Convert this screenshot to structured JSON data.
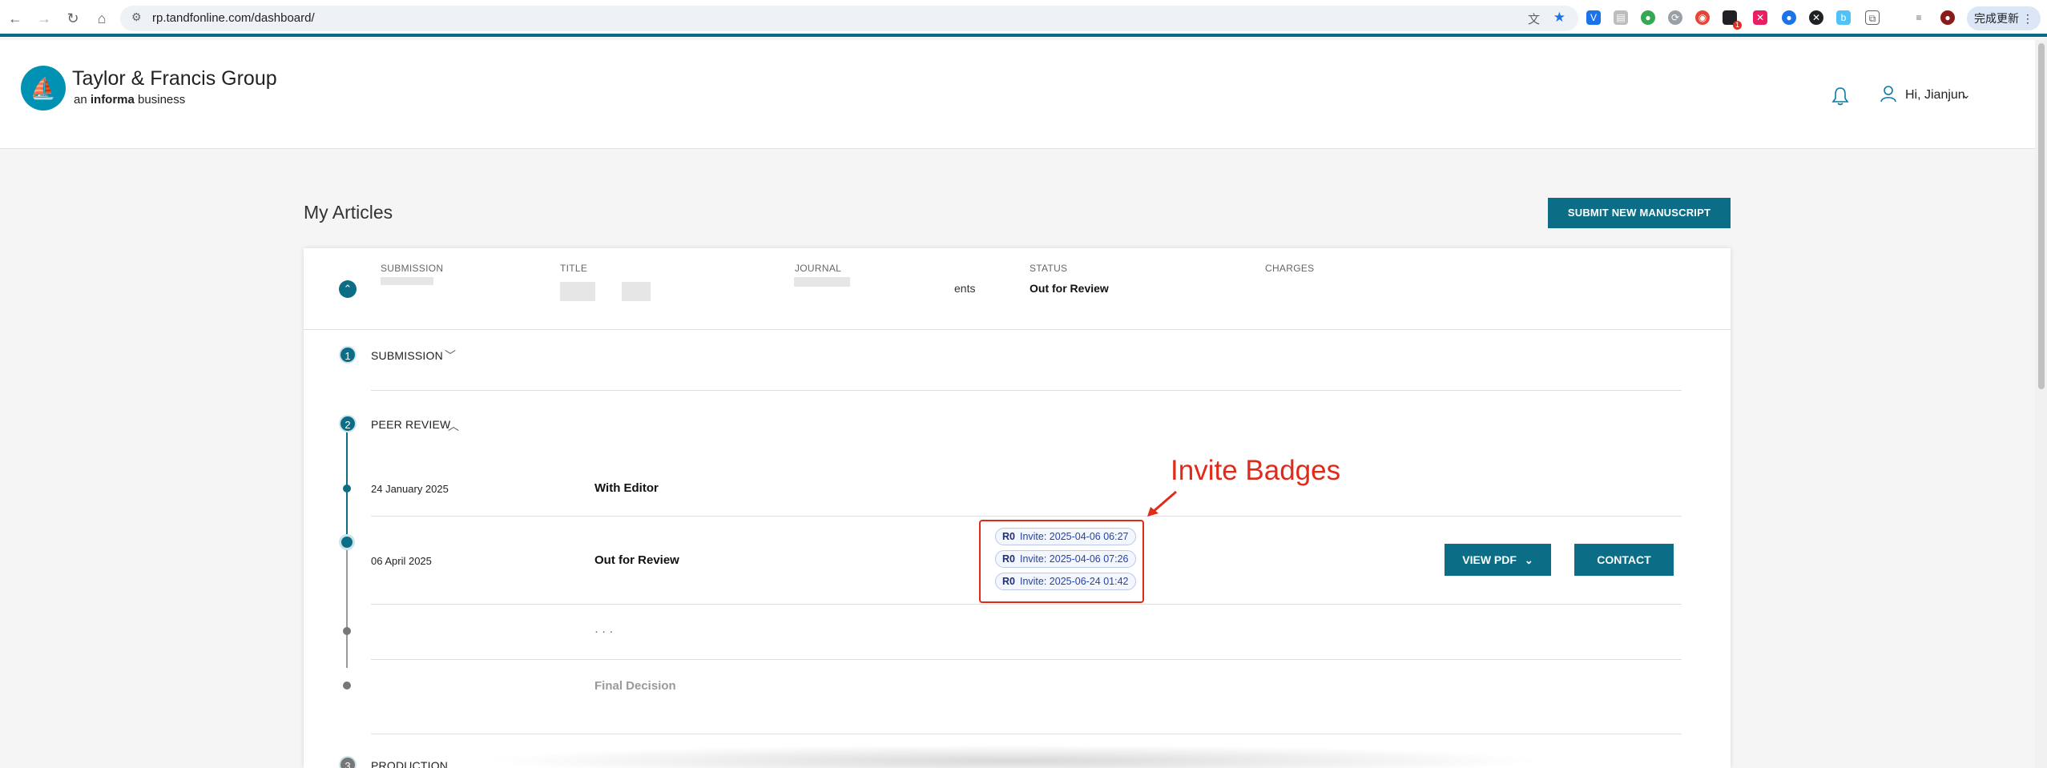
{
  "browser": {
    "url": "rp.tandfonline.com/dashboard/",
    "update_button": "完成更新",
    "extension_badge": "1"
  },
  "header": {
    "brand_name": "Taylor & Francis Group",
    "brand_sub_prefix": "an",
    "brand_sub_bold": "informa",
    "brand_sub_suffix": "business",
    "greeting": "Hi, Jianjun"
  },
  "page": {
    "title": "My Articles",
    "submit_button": "SUBMIT NEW MANUSCRIPT"
  },
  "table": {
    "columns": [
      "SUBMISSION",
      "TITLE",
      "JOURNAL",
      "STATUS",
      "CHARGES"
    ],
    "row": {
      "journal_partial": "ents",
      "status": "Out for Review"
    }
  },
  "steps": [
    {
      "number": "1",
      "label": "SUBMISSION"
    },
    {
      "number": "2",
      "label": "PEER REVIEW"
    },
    {
      "number": "3",
      "label": "PRODUCTION"
    }
  ],
  "timeline": [
    {
      "date": "24 January 2025",
      "status": "With Editor"
    },
    {
      "date": "06 April 2025",
      "status": "Out for Review"
    },
    {
      "date": "",
      "status": "· · ·"
    },
    {
      "date": "",
      "status": "Final Decision"
    }
  ],
  "badges": [
    {
      "round": "R0",
      "text": "Invite: 2025-04-06 06:27"
    },
    {
      "round": "R0",
      "text": "Invite: 2025-04-06 07:26"
    },
    {
      "round": "R0",
      "text": "Invite: 2025-06-24 01:42"
    }
  ],
  "annotation": "Invite Badges",
  "actions": {
    "view_pdf": "VIEW PDF",
    "contact": "CONTACT"
  },
  "colors": {
    "brand_teal": "#0b6e86",
    "annotation_red": "#e02a1a",
    "badge_text": "#2445a8"
  }
}
